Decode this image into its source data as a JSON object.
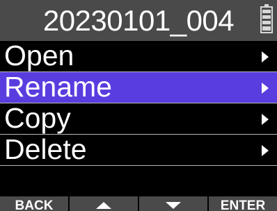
{
  "title": "20230101_004",
  "status": {
    "battery_icon": "battery-icon"
  },
  "menu": {
    "items": [
      {
        "label": "Open",
        "icon": "chevron-right-icon",
        "selected": false
      },
      {
        "label": "Rename",
        "icon": "chevron-right-icon",
        "selected": true
      },
      {
        "label": "Copy",
        "icon": "chevron-right-icon",
        "selected": false
      },
      {
        "label": "Delete",
        "icon": "chevron-right-icon",
        "selected": false
      }
    ]
  },
  "footer": {
    "back_label": "BACK",
    "up_icon": "triangle-up-icon",
    "down_icon": "triangle-down-icon",
    "enter_label": "ENTER"
  },
  "colors": {
    "title_bar": "#4a4a4a",
    "selected_row": "#5a3ddf",
    "divider": "#b9b9b9",
    "soft_key": "#4a4a4a",
    "background": "#000000",
    "text": "#ffffff"
  }
}
